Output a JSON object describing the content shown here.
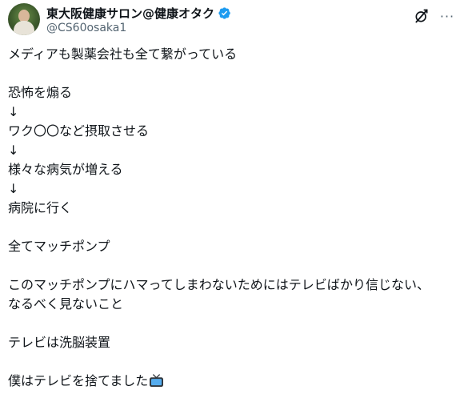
{
  "user": {
    "display_name": "東大阪健康サロン@健康オタク",
    "handle": "@CS60osaka1",
    "verified": true,
    "avatar_icon": "profile-photo",
    "verified_icon": "verified-badge-icon",
    "verified_color": "#1d9bf0"
  },
  "actions": {
    "grok_icon": "grok-icon",
    "more_icon": "more-horizontal-icon",
    "more_label": "···"
  },
  "tweet": {
    "line1": "メディアも製薬会社も全て繋がっている",
    "line2": "恐怖を煽る",
    "arrow1": "↓",
    "line3": "ワク〇〇など摂取させる",
    "arrow2": "↓",
    "line4": "様々な病気が増える",
    "arrow3": "↓",
    "line5": "病院に行く",
    "line6": "全てマッチポンプ",
    "line7": "このマッチポンプにハマってしまわないためにはテレビばかり信じない、",
    "line8": "なるべく見ないこと",
    "line9": "テレビは洗脳装置",
    "line10": "僕はテレビを捨てました",
    "emoji": "television-emoji"
  }
}
